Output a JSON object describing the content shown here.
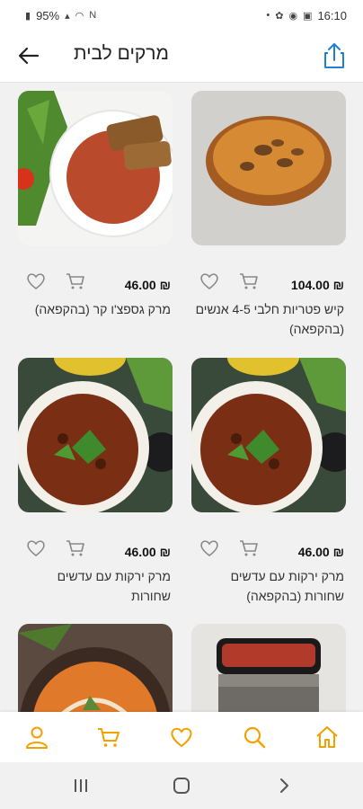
{
  "status_bar": {
    "battery": "95%",
    "time": "16:10"
  },
  "header": {
    "title": "מרקים לבית"
  },
  "currency": "₪",
  "products": [
    {
      "price": "104.00",
      "name": "קיש פטריות חלבי 4-5 אנשים (בהקפאה)",
      "image": "mushroom-quiche"
    },
    {
      "price": "46.00",
      "name": "מרק גספצ'ו קר (בהקפאה)",
      "image": "gazpacho-soup"
    },
    {
      "price": "46.00",
      "name": "מרק ירקות עם עדשים שחורות (בהקפאה)",
      "image": "lentil-soup"
    },
    {
      "price": "46.00",
      "name": "מרק ירקות עם עדשים שחורות",
      "image": "lentil-soup"
    },
    {
      "price": "",
      "name": "",
      "image": "jar-spread"
    },
    {
      "price": "",
      "name": "",
      "image": "pumpkin-soup"
    }
  ],
  "colors": {
    "accent": "#f4a000",
    "share_blue": "#1f7fd6",
    "text": "#222222"
  },
  "bottom_nav": [
    "home-icon",
    "search-icon",
    "heart-icon",
    "cart-icon",
    "user-icon"
  ],
  "system_nav": [
    "recent-apps-icon",
    "home-circle-icon",
    "back-chevron-icon"
  ]
}
